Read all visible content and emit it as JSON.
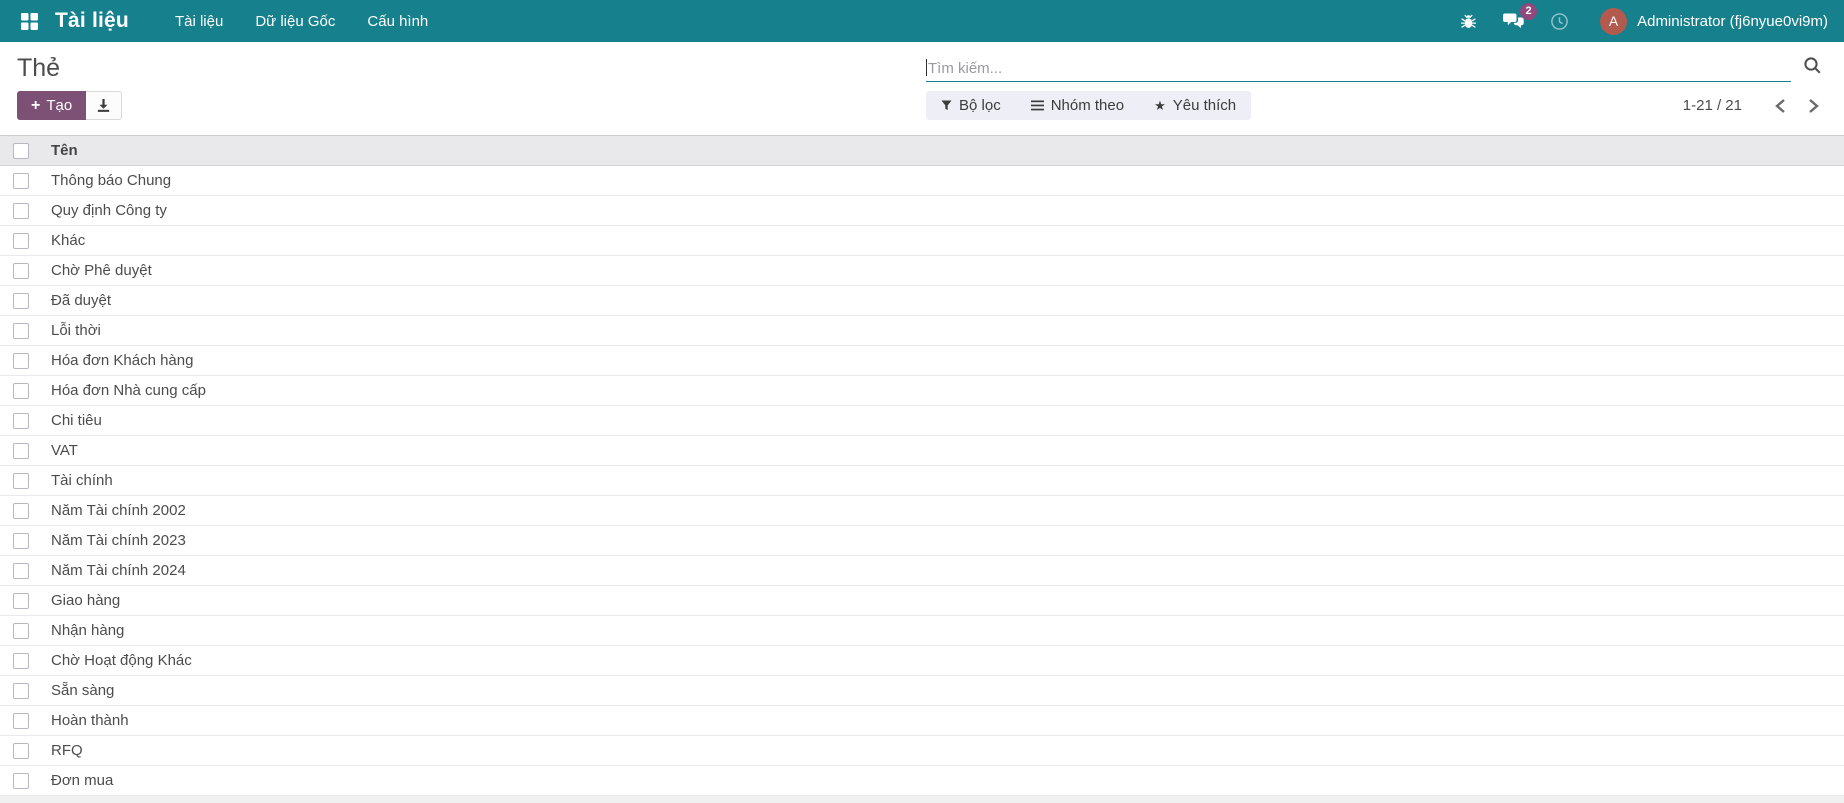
{
  "navbar": {
    "brand": "Tài liệu",
    "menu_items": [
      {
        "label": "Tài liệu"
      },
      {
        "label": "Dữ liệu Gốc"
      },
      {
        "label": "Cấu hình"
      }
    ],
    "message_badge": "2",
    "user": {
      "initial": "A",
      "name": "Administrator (fj6nyue0vi9m)"
    }
  },
  "control_panel": {
    "title": "Thẻ",
    "create_label": "Tạo",
    "search": {
      "placeholder": "Tìm kiếm...",
      "value": ""
    },
    "filters": {
      "filter_label": "Bộ lọc",
      "group_by_label": "Nhóm theo",
      "favorites_label": "Yêu thích"
    },
    "pager": {
      "range": "1-21 / 21"
    }
  },
  "table": {
    "name_header": "Tên",
    "rows": [
      "Thông báo Chung",
      "Quy định Công ty",
      "Khác",
      "Chờ Phê duyệt",
      "Đã duyệt",
      "Lỗi thời",
      "Hóa đơn Khách hàng",
      "Hóa đơn Nhà cung cấp",
      "Chi tiêu",
      "VAT",
      "Tài chính",
      "Năm Tài chính 2002",
      "Năm Tài chính 2023",
      "Năm Tài chính 2024",
      "Giao hàng",
      "Nhận hàng",
      "Chờ Hoạt động Khác",
      "Sẵn sàng",
      "Hoàn thành",
      "RFQ",
      "Đơn mua"
    ]
  },
  "colors": {
    "navbar_teal": "#16808c",
    "primary_purple": "#7d5076",
    "badge_purple": "#8f497e",
    "avatar_red": "#b25a4d",
    "filter_bar_bg": "#eeeef6"
  }
}
